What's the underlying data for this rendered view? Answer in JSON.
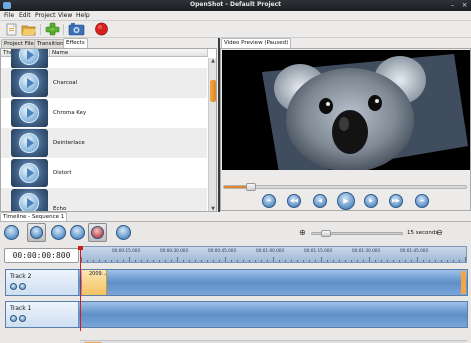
{
  "window": {
    "title": "OpenShot - Default Project"
  },
  "menu": [
    "File",
    "Edit",
    "Project",
    "View",
    "Help"
  ],
  "toolbar": {
    "icons": [
      "new-project-icon",
      "open-project-icon",
      "add-files-icon",
      "export-video-icon",
      "record-icon"
    ]
  },
  "left_panel": {
    "tabs": [
      "Project Files",
      "Transitions",
      "Effects"
    ],
    "active_tab": "Effects",
    "columns": {
      "thumb": "Thumb",
      "name": "Name"
    },
    "effects": [
      "Charcoal",
      "Chroma Key",
      "Deinterlace",
      "Distort",
      "Echo"
    ]
  },
  "preview": {
    "tab": "Video Preview (Paused)",
    "progress_fraction": 0.1
  },
  "timeline": {
    "tab": "Timeline - Sequence 1",
    "timecode": "00:00:00:800",
    "zoom_label": "15 seconds",
    "zoom_fraction": 0.1,
    "ruler": [
      "00:00:15.000",
      "00:00:30.000",
      "00:00:45.000",
      "00:01:00.000",
      "00:01:15.000",
      "00:01:30.000",
      "00:01:45.000"
    ],
    "tracks": [
      {
        "name": "Track 2",
        "clip": "2009..."
      },
      {
        "name": "Track 1"
      }
    ]
  },
  "colors": {
    "accent_orange": "#e08a22",
    "track_blue": "#5f8fc8",
    "playhead_red": "#d01c1c"
  }
}
